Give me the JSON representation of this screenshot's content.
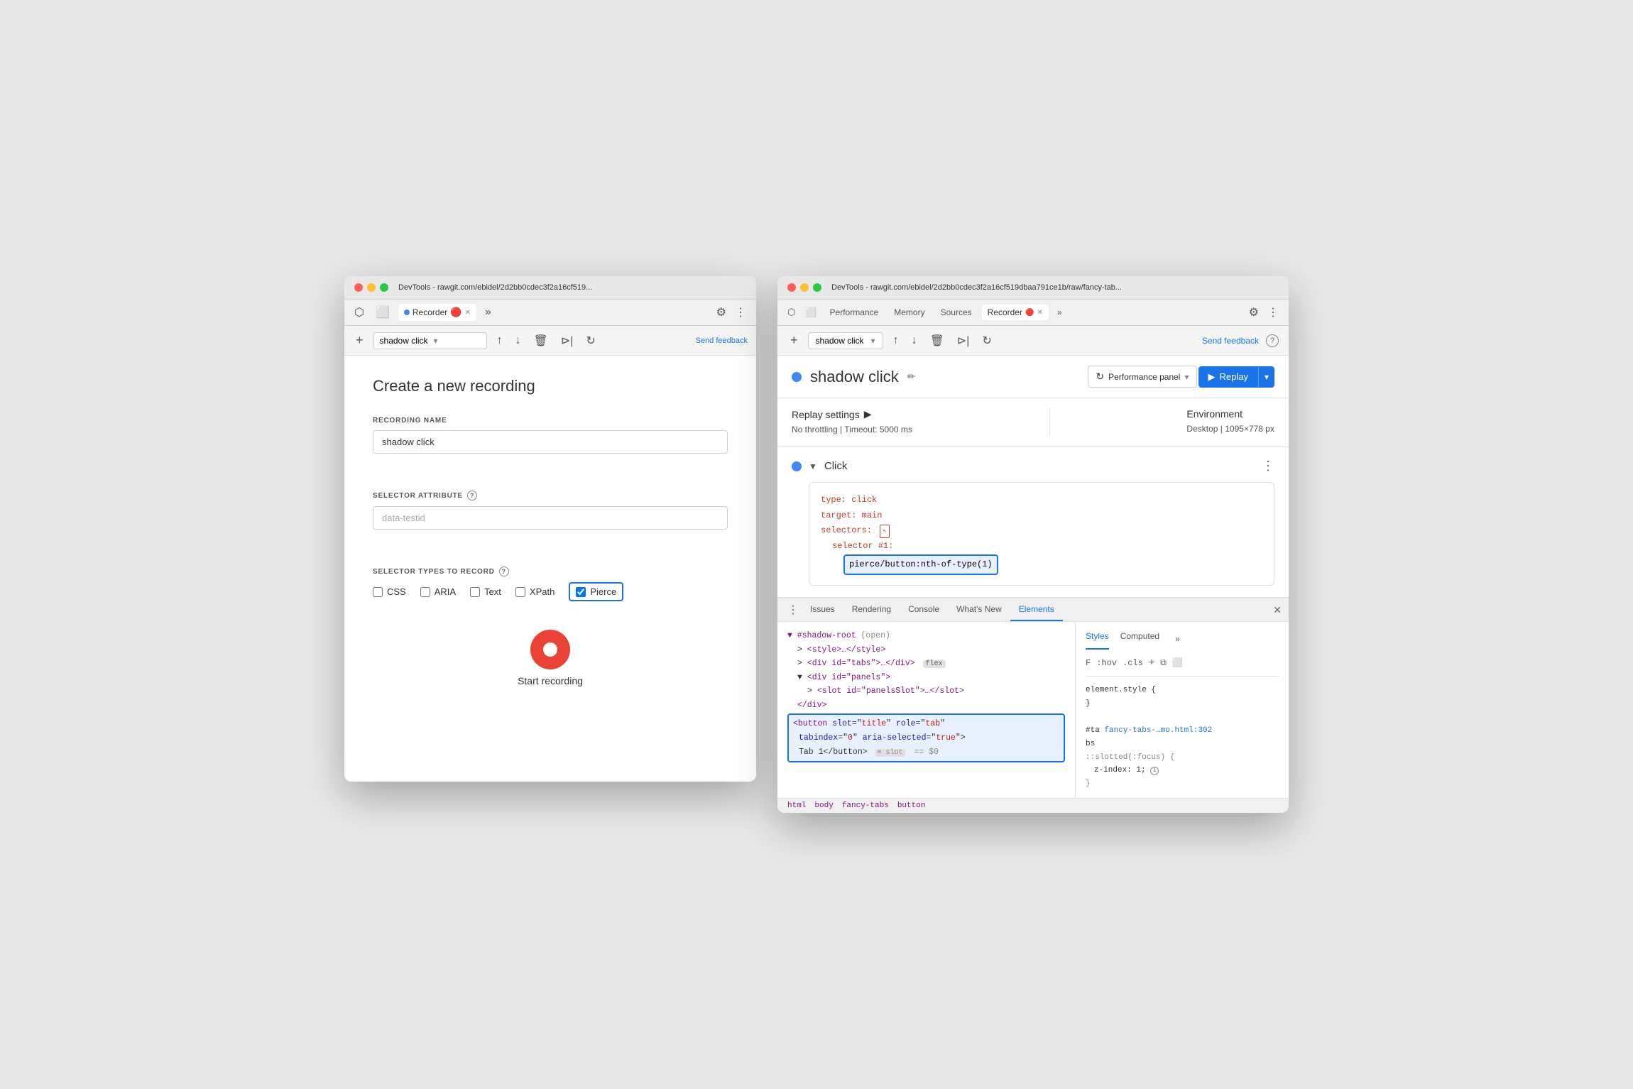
{
  "left_window": {
    "title": "DevTools - rawgit.com/ebidel/2d2bb0cdec3f2a16cf519...",
    "tab_label": "Recorder",
    "tab_dot": true,
    "toolbar": {
      "recording_name": "shadow click",
      "feedback_link": "Send feedback"
    },
    "form": {
      "heading": "Create a new recording",
      "recording_name_label": "RECORDING NAME",
      "recording_name_value": "shadow click",
      "selector_attribute_label": "SELECTOR ATTRIBUTE",
      "selector_attribute_placeholder": "data-testid",
      "selector_types_label": "SELECTOR TYPES TO RECORD",
      "checkboxes": [
        {
          "id": "css",
          "label": "CSS",
          "checked": false
        },
        {
          "id": "aria",
          "label": "ARIA",
          "checked": false
        },
        {
          "id": "text",
          "label": "Text",
          "checked": false
        },
        {
          "id": "xpath",
          "label": "XPath",
          "checked": false
        },
        {
          "id": "pierce",
          "label": "Pierce",
          "checked": true,
          "highlighted": true
        }
      ],
      "start_button_label": "Start recording"
    }
  },
  "right_window": {
    "title": "DevTools - rawgit.com/ebidel/2d2bb0cdec3f2a16cf519dbaa791ce1b/raw/fancy-tab...",
    "tabs": [
      {
        "id": "performance",
        "label": "Performance"
      },
      {
        "id": "memory",
        "label": "Memory"
      },
      {
        "id": "sources",
        "label": "Sources"
      },
      {
        "id": "recorder",
        "label": "Recorder",
        "active": true,
        "dot": true
      }
    ],
    "toolbar": {
      "recording_name": "shadow click",
      "send_feedback": "Send feedback"
    },
    "header": {
      "title": "shadow click",
      "performance_btn": "Performance panel",
      "replay_btn": "Replay"
    },
    "replay_settings": {
      "title": "Replay settings",
      "throttling": "No throttling",
      "timeout": "Timeout: 5000 ms",
      "environment_title": "Environment",
      "desktop": "Desktop",
      "resolution": "1095×778 px"
    },
    "step": {
      "name": "Click",
      "code": {
        "type_key": "type:",
        "type_val": "click",
        "target_key": "target:",
        "target_val": "main",
        "selectors_key": "selectors:",
        "selector_num": "selector #1:",
        "selector_value": "pierce/button:nth-of-type(1)"
      }
    },
    "bottom_tabs": [
      {
        "id": "issues",
        "label": "Issues"
      },
      {
        "id": "rendering",
        "label": "Rendering"
      },
      {
        "id": "console",
        "label": "Console"
      },
      {
        "id": "whats-new",
        "label": "What's New"
      },
      {
        "id": "elements",
        "label": "Elements",
        "active": true
      }
    ],
    "dom_tree": {
      "shadow_root": "▼ #shadow-root",
      "open_badge": "(open)",
      "style_node": "<style>…</style>",
      "tabs_div": "<div id=\"tabs\">…</div>",
      "flex_badge": "flex",
      "panels_div": "<div id=\"panels\">",
      "slot_node": "<slot id=\"panelsSlot\">…</slot>",
      "slot_close": "</div>",
      "highlighted_button": "<button slot=\"title\" role=\"tab\"",
      "highlighted_button2": "tabindex=\"0\" aria-selected=\"true\">",
      "highlighted_button3": "Tab 1</button>",
      "slot_badge": "≡ slot",
      "eq0": "== $0"
    },
    "styles": {
      "tabs": [
        "Styles",
        "Computed"
      ],
      "toolbar_items": [
        "F",
        ":hov",
        ".cls",
        "+"
      ],
      "element_style": "element.style {",
      "element_style_close": "}",
      "selector": "#ta",
      "selector_file": "fancy-tabs-…mo.html:302",
      "selector_text": "bs",
      "pseudo_selector": "::slotted(:focus) {",
      "style_prop": "z-index: 1;",
      "pseudo_close": "}"
    },
    "bottom_bar": [
      "html",
      "body",
      "fancy-tabs",
      "button"
    ]
  }
}
